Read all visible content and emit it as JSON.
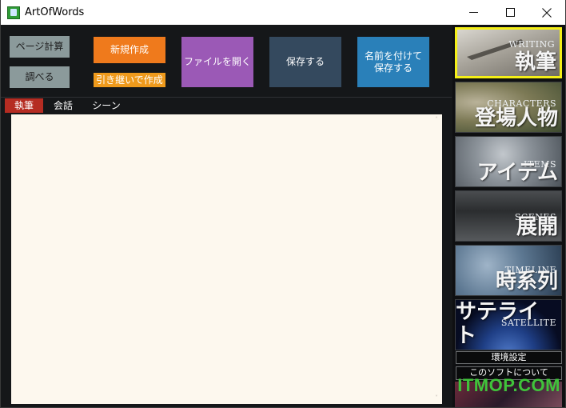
{
  "window": {
    "title": "ArtOfWords",
    "minimize_symbol": "—",
    "maximize_symbol": "☐",
    "close_symbol": "✕"
  },
  "toolbar": {
    "page_calc": "ページ計算",
    "lookup": "調べる",
    "new_create": "新規作成",
    "inherit_create": "引き継いで作成",
    "open_file": "ファイルを開く",
    "save": "保存する",
    "save_as_line1": "名前を付けて",
    "save_as_line2": "保存する",
    "colors": {
      "orange": "#ef7a1c",
      "purple": "#9b59b6",
      "darkslate": "#34495e",
      "blue": "#2a80b9",
      "gray": "#8b9a9b"
    }
  },
  "tabs": [
    {
      "label": "執筆",
      "active": true
    },
    {
      "label": "会話",
      "active": false
    },
    {
      "label": "シーン",
      "active": false
    }
  ],
  "editor": {
    "content": "",
    "scroll_up": "˄",
    "scroll_down": "˅"
  },
  "sidebar": {
    "tiles": [
      {
        "en": "WRITING",
        "jp": "執筆",
        "active": true,
        "icon": "pen-writing-image"
      },
      {
        "en": "CHARACTERS",
        "jp": "登場人物",
        "active": false,
        "icon": "portrait-image"
      },
      {
        "en": "ITEMS",
        "jp": "アイテム",
        "active": false,
        "icon": "pocket-watch-image"
      },
      {
        "en": "SCENES",
        "jp": "展開",
        "active": false,
        "icon": "clapperboard-image"
      },
      {
        "en": "TIMELINE",
        "jp": "時系列",
        "active": false,
        "icon": "clock-image"
      },
      {
        "en": "SATELLITE",
        "jp": "サテライト",
        "active": false,
        "icon": "earth-satellite-image"
      }
    ],
    "settings": "環境設定",
    "about": "このソフトについて"
  },
  "watermark": "ITMOP.COM"
}
